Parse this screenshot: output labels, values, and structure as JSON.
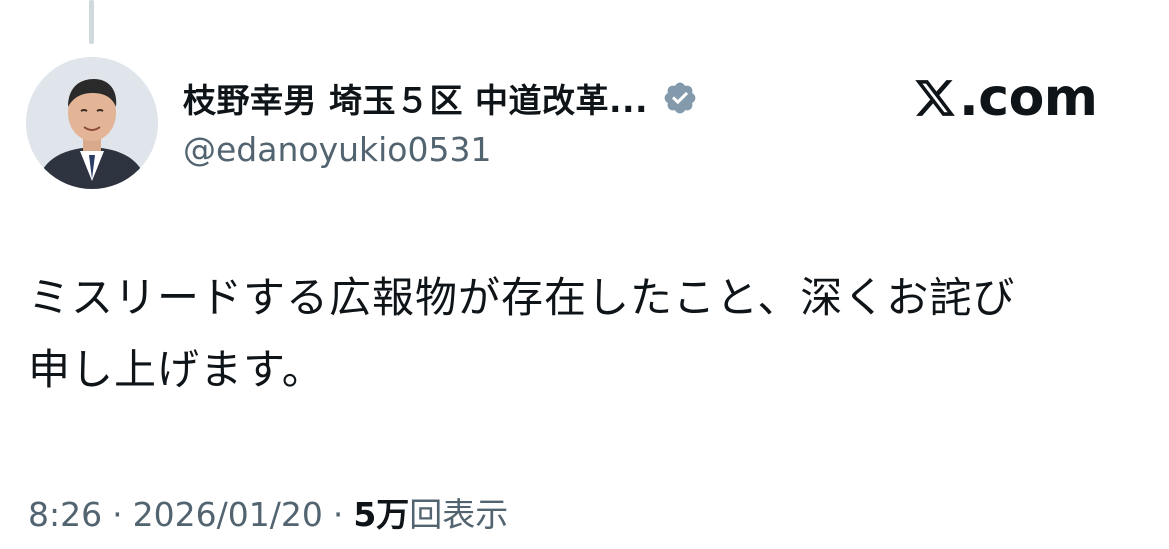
{
  "author": {
    "display_name": "枝野幸男 埼玉５区 中道改革...",
    "handle": "@edanoyukio0531",
    "verified": true
  },
  "brand": {
    "text": ".com",
    "logo": "x-logo-icon"
  },
  "tweet": {
    "lines": [
      "ミスリードする広報物が存在したこと、深くお詫び",
      "申し上げます。"
    ]
  },
  "meta": {
    "time": "8:26",
    "date": "2026/01/20",
    "separator": "·",
    "views_count": "5万",
    "views_label": "回表示"
  },
  "colors": {
    "text": "#0f1419",
    "secondary": "#536471",
    "verified_badge": "#829aab",
    "thread_line": "#cfd9de"
  }
}
